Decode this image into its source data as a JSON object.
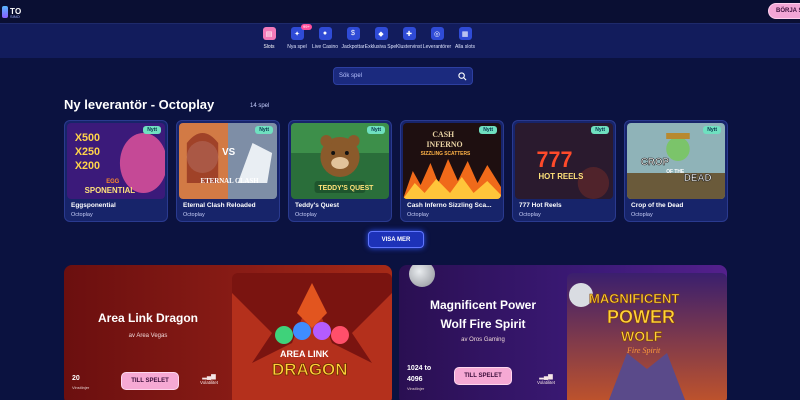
{
  "header": {
    "logo_text": "TO",
    "logo_sub": "SINO",
    "start_label": "BÖRJA S"
  },
  "categories": [
    {
      "label": "Slots",
      "icon": "slot-machine-icon",
      "active": true
    },
    {
      "label": "Nya spel",
      "icon": "sparkle-icon",
      "badge": "99+"
    },
    {
      "label": "Live Casino",
      "icon": "live-dealer-icon"
    },
    {
      "label": "Jackpottar",
      "icon": "money-bag-icon"
    },
    {
      "label": "Exklusiva Spel",
      "icon": "diamond-icon"
    },
    {
      "label": "Klustervinst",
      "icon": "cluster-icon"
    },
    {
      "label": "Leverantörer",
      "icon": "provider-icon"
    },
    {
      "label": "Alla slots",
      "icon": "grid-icon"
    }
  ],
  "search": {
    "placeholder": "Sök spel"
  },
  "section": {
    "title": "Ny leverantör - Octoplay",
    "count": "14 spel",
    "games": [
      {
        "name": "Eggsponential",
        "provider": "Octoplay",
        "badge": "Nytt"
      },
      {
        "name": "Eternal Clash Reloaded",
        "provider": "Octoplay",
        "badge": "Nytt"
      },
      {
        "name": "Teddy's Quest",
        "provider": "Octoplay",
        "badge": "Nytt"
      },
      {
        "name": "Cash Inferno Sizzling Sca...",
        "provider": "Octoplay",
        "badge": "Nytt"
      },
      {
        "name": "777 Hot Reels",
        "provider": "Octoplay",
        "badge": "Nytt"
      },
      {
        "name": "Crop of the Dead",
        "provider": "Octoplay",
        "badge": "Nytt"
      }
    ],
    "show_more": "VISA MER"
  },
  "thumb_text": {
    "eggs": [
      "X500",
      "X250",
      "X200",
      "EGG",
      "SPONENTIAL"
    ],
    "clash": [
      "VS",
      "ETERNAL CLASH"
    ],
    "teddy": "TEDDY'S QUEST",
    "cash": [
      "CASH",
      "INFERNO",
      "SIZZLING SCATTERS"
    ],
    "hot": [
      "777",
      "HOT REELS"
    ],
    "crop": [
      "CROP",
      "OF THE",
      "DEAD"
    ]
  },
  "promos": [
    {
      "title": "Area Link Dragon",
      "provider": "av Area Vegas",
      "ways": "20",
      "ways_label": "Vinstlinjer",
      "play": "TILL SPELET",
      "volatility_label": "Volatilitet",
      "art_text": [
        "AREA LINK",
        "DRAGON"
      ]
    },
    {
      "title": "Magnificent Power Wolf Fire Spirit",
      "title_line1": "Magnificent Power",
      "title_line2": "Wolf Fire Spirit",
      "provider": "av Oros Gaming",
      "ways_line1": "1024 to",
      "ways_line2": "4096",
      "ways_label": "Vinstlinjer",
      "play": "TILL SPELET",
      "volatility_label": "Volatilitet",
      "art_text": [
        "MAGNIFICENT",
        "POWER",
        "WOLF",
        "Fire Spirit"
      ]
    }
  ],
  "colors": {
    "background": "#0b1240",
    "accent_pink": "#f3a6d6",
    "badge_new": "#6fe0c0",
    "button_blue": "#1d32b8"
  }
}
